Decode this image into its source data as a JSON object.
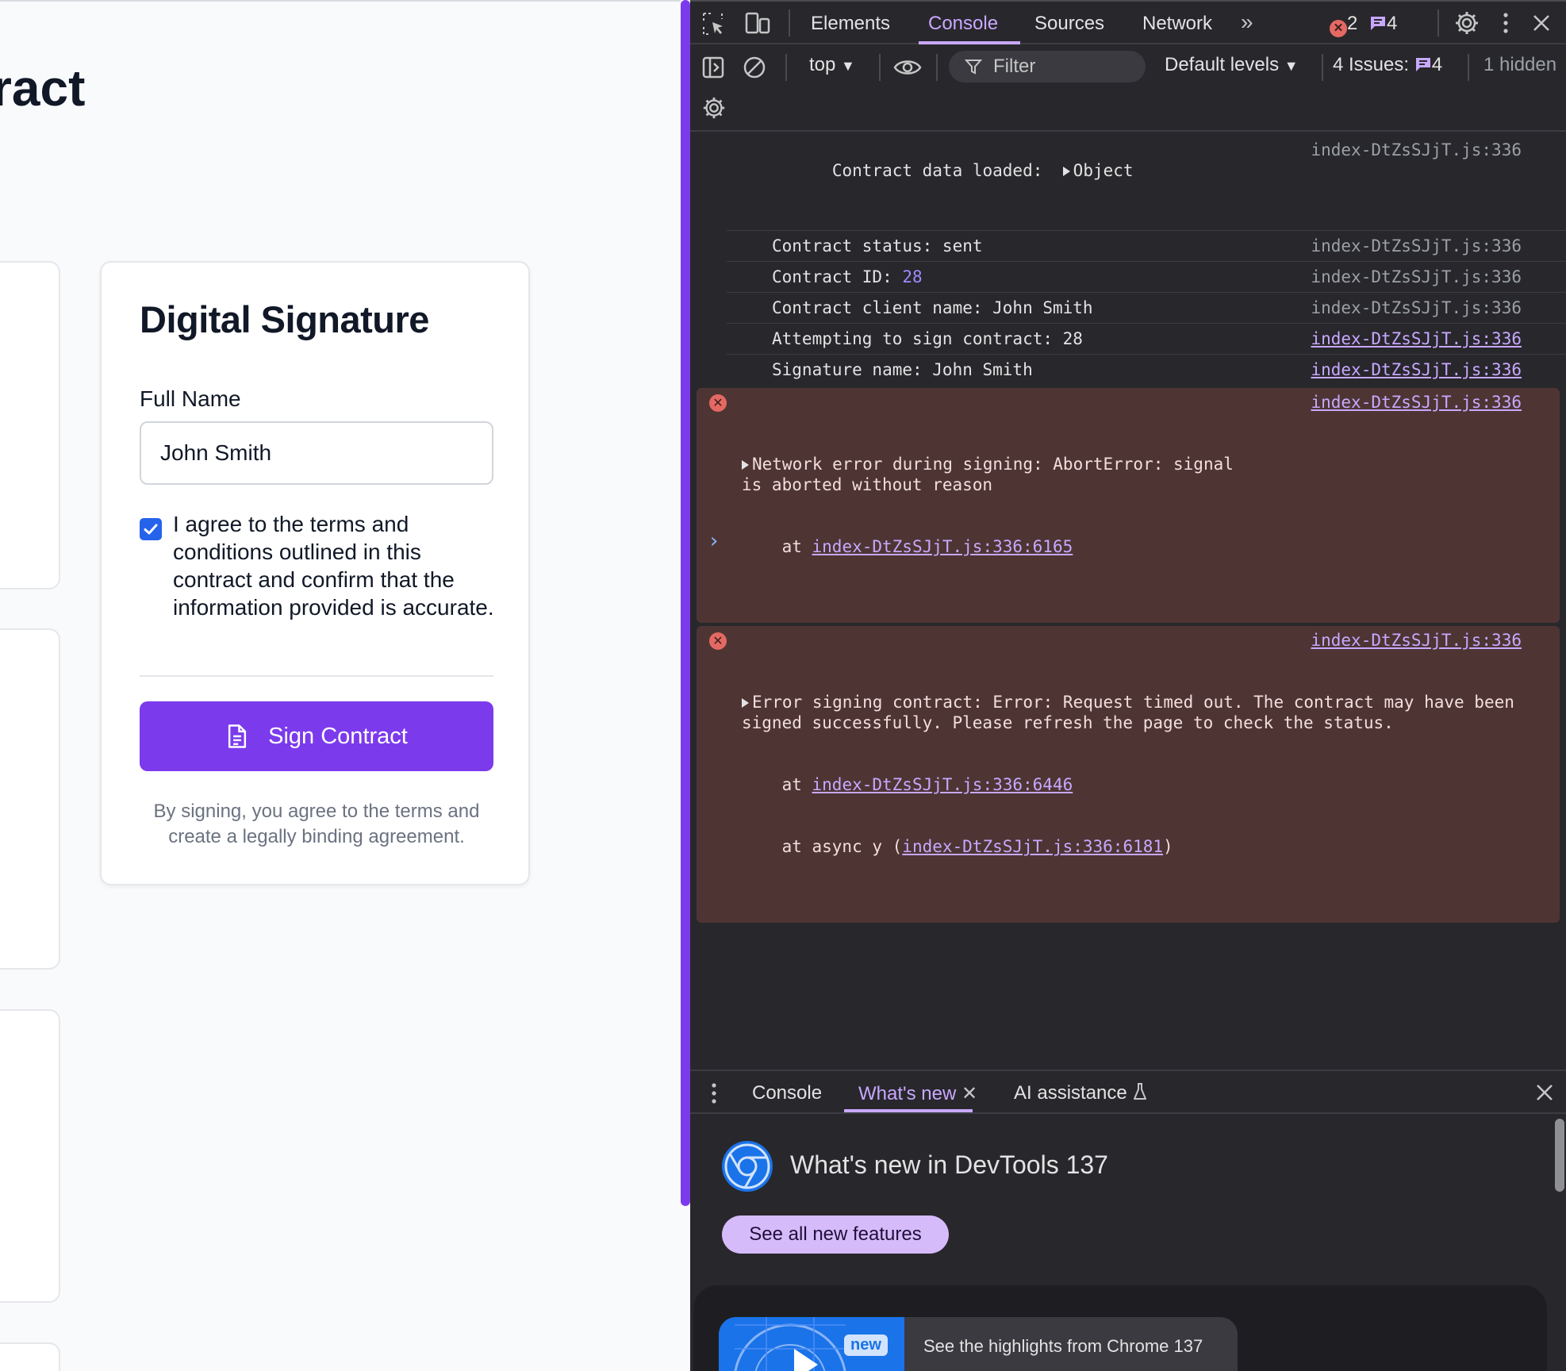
{
  "page": {
    "heading": "ract",
    "signature_card": {
      "title": "Digital Signature",
      "name_label": "Full Name",
      "name_value": "John Smith",
      "agree_text": "I agree to the terms and conditions outlined in this contract and confirm that the information provided is accurate.",
      "agree_checked": true,
      "sign_button_label": "Sign Contract",
      "note": "By signing, you agree to the terms and create a legally binding agreement."
    }
  },
  "devtools": {
    "tabs": [
      "Elements",
      "Console",
      "Sources",
      "Network"
    ],
    "active_tab": "Console",
    "error_count": "2",
    "message_count": "4",
    "toolbar": {
      "context": "top",
      "filter_placeholder": "Filter",
      "levels": "Default levels",
      "issues_label": "4 Issues:",
      "issues_count": "4",
      "hidden": "1 hidden"
    },
    "log": [
      {
        "text": "Contract data loaded:",
        "object": "Object",
        "source": "index-DtZsSJjT.js:336"
      },
      {
        "text": "Contract status: sent",
        "source": "index-DtZsSJjT.js:336"
      },
      {
        "text": "Contract ID: ",
        "number": "28",
        "source": "index-DtZsSJjT.js:336"
      },
      {
        "text": "Contract client name: John Smith",
        "source": "index-DtZsSJjT.js:336"
      },
      {
        "text": "Attempting to sign contract: 28",
        "source": "index-DtZsSJjT.js:336"
      },
      {
        "text": "Signature name: John Smith",
        "source": "index-DtZsSJjT.js:336"
      }
    ],
    "errors": [
      {
        "message": "Network error during signing: AbortError: signal is aborted without reason",
        "stack_prefix": "    at ",
        "stack_link": "index-DtZsSJjT.js:336:6165",
        "source": "index-DtZsSJjT.js:336"
      },
      {
        "message": "Error signing contract: Error: Request timed out. The contract may have been signed successfully. Please refresh the page to check the status.",
        "stack_prefix": "    at ",
        "stack_link": "index-DtZsSJjT.js:336:6446",
        "stack2_prefix": "    at async y (",
        "stack2_link": "index-DtZsSJjT.js:336:6181",
        "stack2_suffix": ")",
        "source": "index-DtZsSJjT.js:336"
      }
    ],
    "drawer": {
      "tabs": [
        "Console",
        "What's new",
        "AI assistance"
      ],
      "active_tab": "What's new",
      "title": "What's new in DevTools 137",
      "see_all_label": "See all new features",
      "new_badge": "new",
      "highlight_text": "See the highlights from Chrome 137"
    }
  },
  "colors": {
    "accent_purple": "#7c3aed",
    "devtools_bg": "#28272c",
    "error_bg": "#4e3534",
    "link": "#c8a8ff"
  }
}
